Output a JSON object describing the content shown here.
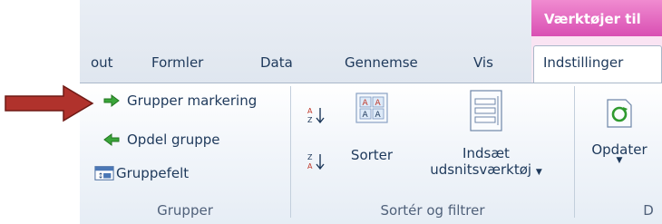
{
  "tabs": [
    {
      "label": "out"
    },
    {
      "label": "Formler"
    },
    {
      "label": "Data"
    },
    {
      "label": "Gennemse"
    },
    {
      "label": "Vis"
    },
    {
      "label": "Indstillinger"
    }
  ],
  "context_group": {
    "label": "Værktøjer til"
  },
  "groups": {
    "grupper": {
      "label": "Grupper",
      "items": [
        {
          "label": "Grupper markering",
          "icon": "green-arrow-right-icon"
        },
        {
          "label": "Opdel gruppe",
          "icon": "green-arrow-left-icon"
        },
        {
          "label": "Gruppefelt",
          "icon": "group-field-icon"
        }
      ]
    },
    "sorter": {
      "label": "Sortér og filtrer",
      "sort_az_icon": "sort-ascending-icon",
      "sort_za_icon": "sort-descending-icon",
      "sort_button": {
        "label": "Sorter",
        "icon": "sort-dialog-icon"
      },
      "insert_slicer": {
        "line1": "Indsæt",
        "line2": "udsnitsværktøj",
        "icon": "slicer-icon"
      }
    },
    "data": {
      "label": "D",
      "refresh": {
        "label": "Opdater",
        "icon": "refresh-icon"
      }
    }
  },
  "colors": {
    "context_header": "#d94fb3",
    "arrow": "#b0322c",
    "text": "#1e395b"
  }
}
